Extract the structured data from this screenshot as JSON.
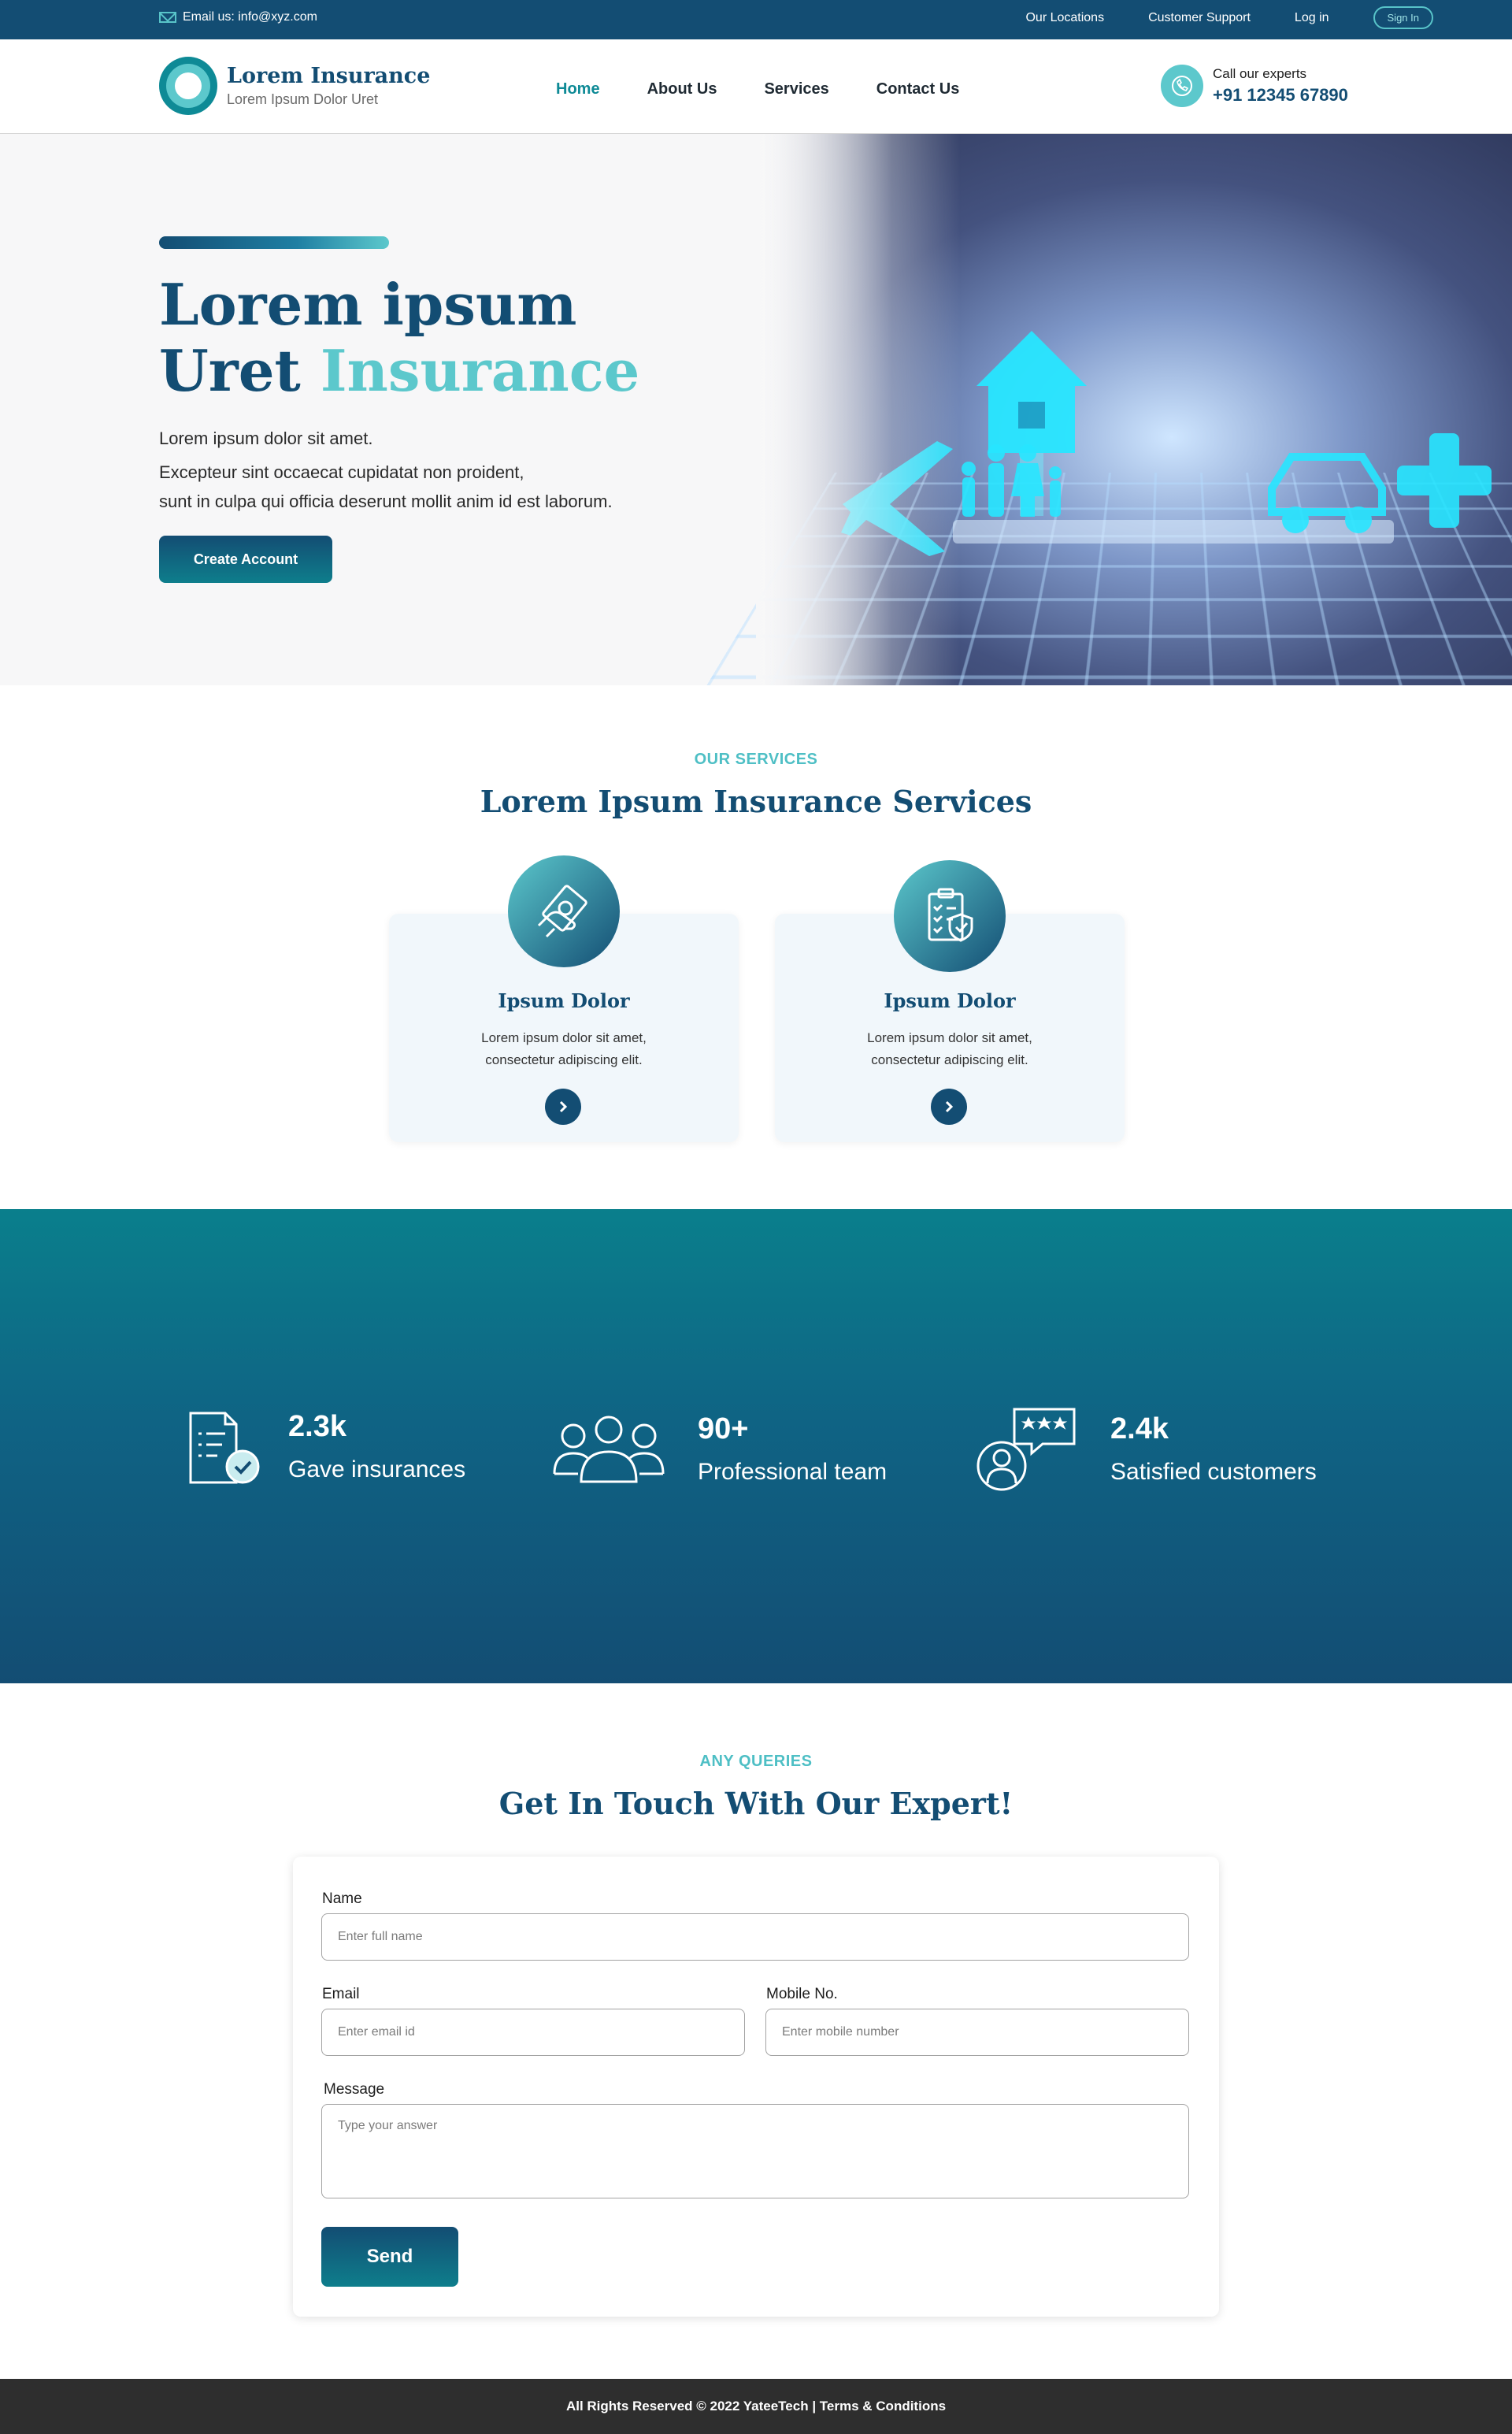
{
  "topbar": {
    "email_label": "Email us: info@xyz.com",
    "links": [
      "Our Locations",
      "Customer Support",
      "Log in"
    ],
    "signin_label": "Sign In"
  },
  "header": {
    "logo_title": "Lorem Insurance",
    "logo_subtitle": "Lorem Ipsum Dolor Uret",
    "nav": [
      "Home",
      "About Us",
      "Services",
      "Contact Us"
    ],
    "active_nav": "Home",
    "call_label": "Call our experts",
    "call_number": "+91 12345 67890"
  },
  "hero": {
    "title_line1": "Lorem ipsum",
    "title_word": "Uret",
    "title_accent": "Insurance",
    "text1": "Lorem ipsum dolor sit amet.",
    "text2": "Excepteur sint occaecat cupidatat non proident,",
    "text3": "sunt in culpa qui officia deserunt mollit anim id est laborum.",
    "button": "Create Account",
    "image_icons": [
      "house-icon",
      "plane-icon",
      "family-icon",
      "car-icon",
      "health-cross-icon"
    ]
  },
  "services": {
    "eyebrow": "OUR SERVICES",
    "title": "Lorem Ipsum Insurance Services",
    "cards": [
      {
        "title": "Ipsum Dolor",
        "text1": "Lorem ipsum dolor sit amet,",
        "text2": "consectetur adipiscing elit.",
        "icon": "money-hand-icon"
      },
      {
        "title": "Ipsum Dolor",
        "text1": "Lorem ipsum dolor sit amet,",
        "text2": "consectetur adipiscing elit.",
        "icon": "clipboard-shield-icon"
      }
    ]
  },
  "stats": [
    {
      "number": "2.3k",
      "label": "Gave insurances",
      "icon": "document-check-icon"
    },
    {
      "number": "90+",
      "label": "Professional team",
      "icon": "team-icon"
    },
    {
      "number": "2.4k",
      "label": "Satisfied customers",
      "icon": "customer-rating-icon"
    }
  ],
  "contact": {
    "eyebrow": "ANY QUERIES",
    "title": "Get In Touch With Our Expert!",
    "name_label": "Name",
    "name_placeholder": "Enter full name",
    "email_label": "Email",
    "email_placeholder": "Enter email id",
    "mobile_label": "Mobile No.",
    "mobile_placeholder": "Enter mobile number",
    "message_label": "Message",
    "message_placeholder": "Type your answer",
    "send_label": "Send"
  },
  "footer": {
    "text": "All Rights Reserved © 2022 YateeTech | Terms & Conditions"
  },
  "colors": {
    "primary": "#134d73",
    "accent": "#5cc8cc",
    "teal": "#0e8a96",
    "footer": "#2e2e2e"
  }
}
